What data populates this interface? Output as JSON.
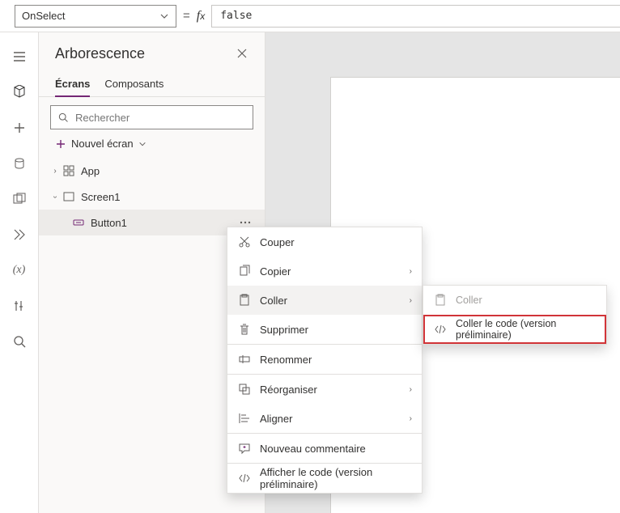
{
  "formula": {
    "property": "OnSelect",
    "value": "false"
  },
  "tree": {
    "title": "Arborescence",
    "tabs": {
      "screens": "Écrans",
      "components": "Composants"
    },
    "search_placeholder": "Rechercher",
    "new_screen": "Nouvel écran",
    "items": {
      "app": "App",
      "screen1": "Screen1",
      "button1": "Button1"
    }
  },
  "context_menu": {
    "cut": "Couper",
    "copy": "Copier",
    "paste": "Coller",
    "delete": "Supprimer",
    "rename": "Renommer",
    "reorder": "Réorganiser",
    "align": "Aligner",
    "new_comment": "Nouveau commentaire",
    "view_code": "Afficher le code (version préliminaire)"
  },
  "submenu": {
    "paste": "Coller",
    "paste_code": "Coller le code (version préliminaire)"
  }
}
